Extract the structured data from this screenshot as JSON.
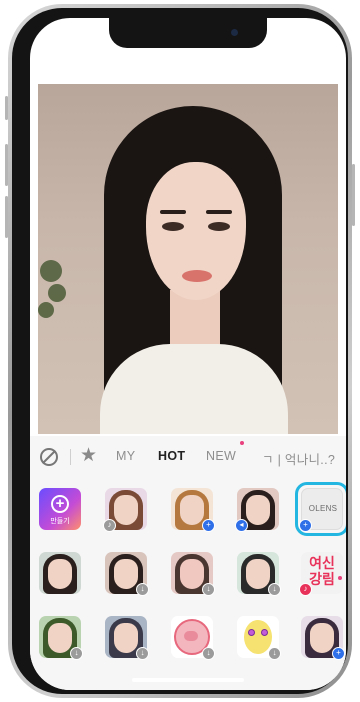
{
  "filter_tabs": {
    "none_icon": "no-filter-icon",
    "favorites_icon": "star-icon",
    "tabs": [
      "MY",
      "HOT",
      "NEW",
      "ㄱ | 억나니..?"
    ],
    "active_tab": "HOT"
  },
  "grid": {
    "create_label": "만들기",
    "olens_label": "OLENS",
    "korean_tile_text": "여신\n강림",
    "selected_tile": "OLENS"
  },
  "colors": {
    "selection_outline": "#22b6e0",
    "new_dot": "#e8417e",
    "plus_badge": "#2f6fe8",
    "download_badge": "#9b9b9b"
  }
}
